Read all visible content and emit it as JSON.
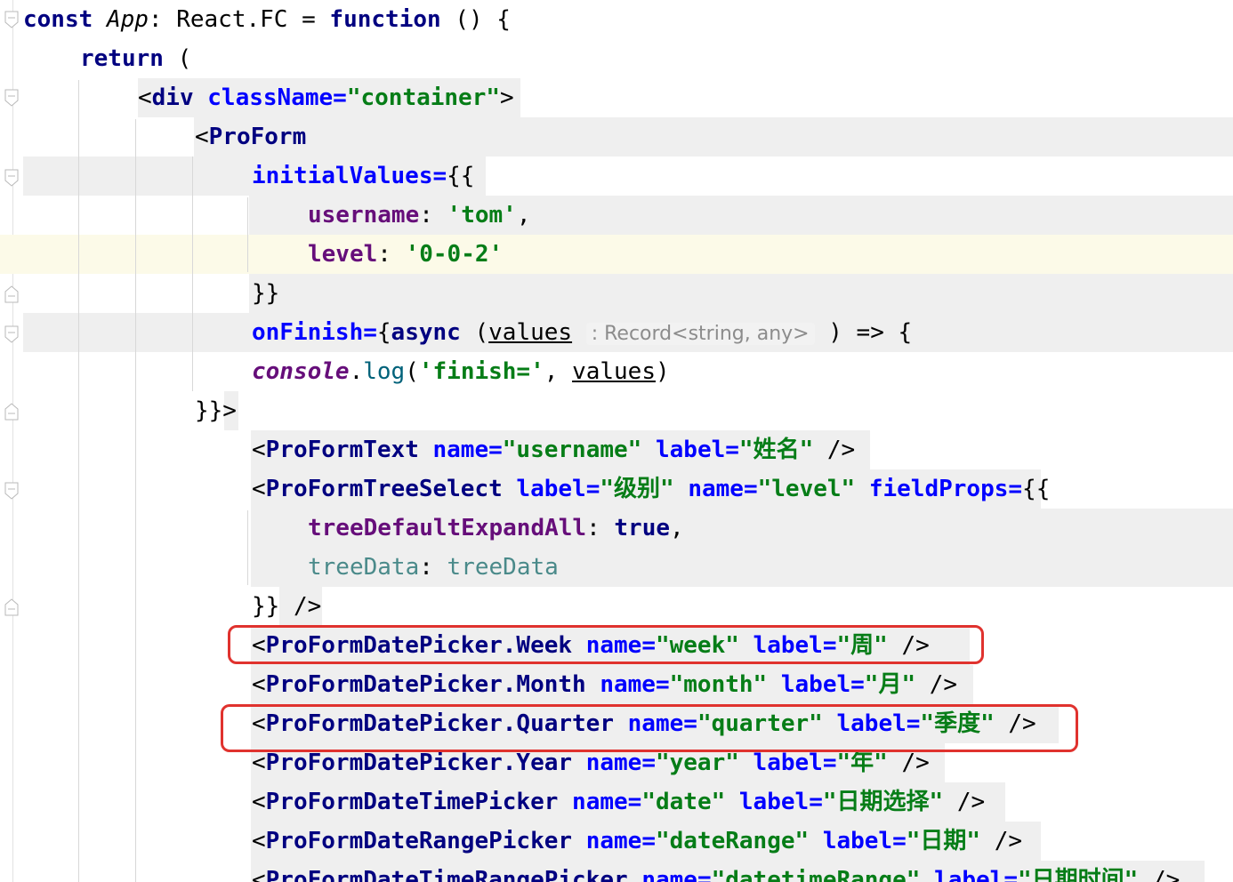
{
  "code": {
    "l1": {
      "kw_const": "const",
      "name": "App",
      "colon": ":",
      "type": "React.FC",
      "eq": "=",
      "kw_function": "function",
      "tail": "() {"
    },
    "l2": {
      "kw_return": "return",
      "paren": "("
    },
    "l3": {
      "open": "<",
      "tag": "div",
      "attr": "className",
      "eq": "=",
      "value": "\"container\"",
      "close": ">"
    },
    "l4": {
      "open": "<",
      "tag": "ProForm"
    },
    "l5": {
      "attr": "initialValues",
      "eq": "=",
      "brace": "{{"
    },
    "l6": {
      "key": "username",
      "colon": ":",
      "value": "'tom'",
      "comma": ","
    },
    "l7": {
      "key": "level",
      "colon": ":",
      "value": "'0-0-2'"
    },
    "l8": {
      "brace": "}}"
    },
    "l9": {
      "attr": "onFinish",
      "eq": "=",
      "brace": "{",
      "kw_async": "async",
      "lparen": "(",
      "param": "values",
      "hint": ": Record<string, any>",
      "tail": ") => {"
    },
    "l10": {
      "obj": "console",
      "dot": ".",
      "method": "log",
      "lparen": "(",
      "str": "'finish='",
      "comma": ",",
      "arg": "values",
      "rparen": ")"
    },
    "l11": {
      "brace": "}}>"
    },
    "l12": {
      "open": "<",
      "tag": "ProFormText",
      "a1": "name",
      "eq1": "=",
      "v1": "\"username\"",
      "a2": "label",
      "eq2": "=",
      "v2": "\"姓名\"",
      "close": "/>"
    },
    "l13": {
      "open": "<",
      "tag": "ProFormTreeSelect",
      "a1": "label",
      "eq1": "=",
      "v1": "\"级别\"",
      "a2": "name",
      "eq2": "=",
      "v2": "\"level\"",
      "a3": "fieldProps",
      "eq3": "=",
      "brace": "{{"
    },
    "l14": {
      "key": "treeDefaultExpandAll",
      "colon": ":",
      "value": "true",
      "comma": ","
    },
    "l15": {
      "key": "treeData",
      "colon": ":",
      "value": "treeData"
    },
    "l16": {
      "brace": "}}",
      "close": "/>"
    },
    "l17": {
      "open": "<",
      "tag": "ProFormDatePicker.Week",
      "a1": "name",
      "eq1": "=",
      "v1": "\"week\"",
      "a2": "label",
      "eq2": "=",
      "v2": "\"周\"",
      "close": "/>"
    },
    "l18": {
      "open": "<",
      "tag": "ProFormDatePicker.Month",
      "a1": "name",
      "eq1": "=",
      "v1": "\"month\"",
      "a2": "label",
      "eq2": "=",
      "v2": "\"月\"",
      "close": "/>"
    },
    "l19": {
      "open": "<",
      "tag": "ProFormDatePicker.Quarter",
      "a1": "name",
      "eq1": "=",
      "v1": "\"quarter\"",
      "a2": "label",
      "eq2": "=",
      "v2": "\"季度\"",
      "close": "/>"
    },
    "l20": {
      "open": "<",
      "tag": "ProFormDatePicker.Year",
      "a1": "name",
      "eq1": "=",
      "v1": "\"year\"",
      "a2": "label",
      "eq2": "=",
      "v2": "\"年\"",
      "close": "/>"
    },
    "l21": {
      "open": "<",
      "tag": "ProFormDateTimePicker",
      "a1": "name",
      "eq1": "=",
      "v1": "\"date\"",
      "a2": "label",
      "eq2": "=",
      "v2": "\"日期选择\"",
      "close": "/>"
    },
    "l22": {
      "open": "<",
      "tag": "ProFormDateRangePicker",
      "a1": "name",
      "eq1": "=",
      "v1": "\"dateRange\"",
      "a2": "label",
      "eq2": "=",
      "v2": "\"日期\"",
      "close": "/>"
    },
    "l23": {
      "open": "<",
      "tag": "ProFormDateTimeRangePicker",
      "a1": "name",
      "eq1": "=",
      "v1": "\"datetimeRange\"",
      "a2": "label",
      "eq2": "=",
      "v2": "\"日期时间\"",
      "close": "/>"
    }
  },
  "colors": {
    "keyword": "#000080",
    "attribute": "#0000ff",
    "string": "#067d17",
    "property": "#660e7a",
    "annotation_box": "#e0322e",
    "caret_line": "#fcfae8",
    "block_highlight": "#efefef"
  },
  "icons": {
    "fold_open": "fold-open-icon",
    "fold_close": "fold-close-icon"
  }
}
